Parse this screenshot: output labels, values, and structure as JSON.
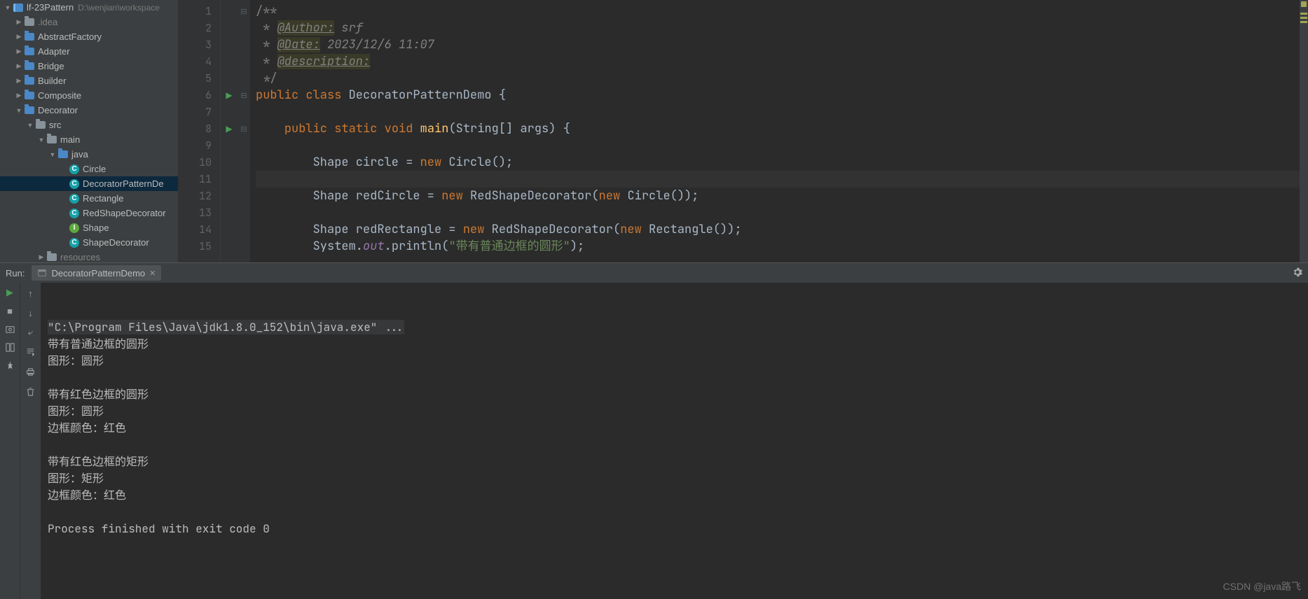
{
  "project": {
    "root_name": "lf-23Pattern",
    "root_path": "D:\\wenjian\\workspace",
    "items": [
      {
        "indent": 0,
        "arrow": "expanded",
        "icon": "module",
        "label": "lf-23Pattern",
        "hint": "D:\\wenjian\\workspace",
        "selected": false
      },
      {
        "indent": 1,
        "arrow": "collapsed",
        "icon": "folder",
        "label": ".idea",
        "dim": true
      },
      {
        "indent": 1,
        "arrow": "collapsed",
        "icon": "folder-blue",
        "label": "AbstractFactory"
      },
      {
        "indent": 1,
        "arrow": "collapsed",
        "icon": "folder-blue",
        "label": "Adapter"
      },
      {
        "indent": 1,
        "arrow": "collapsed",
        "icon": "folder-blue",
        "label": "Bridge"
      },
      {
        "indent": 1,
        "arrow": "collapsed",
        "icon": "folder-blue",
        "label": "Builder"
      },
      {
        "indent": 1,
        "arrow": "collapsed",
        "icon": "folder-blue",
        "label": "Composite"
      },
      {
        "indent": 1,
        "arrow": "expanded",
        "icon": "folder-blue",
        "label": "Decorator"
      },
      {
        "indent": 2,
        "arrow": "expanded",
        "icon": "folder",
        "label": "src"
      },
      {
        "indent": 3,
        "arrow": "expanded",
        "icon": "folder",
        "label": "main"
      },
      {
        "indent": 4,
        "arrow": "expanded",
        "icon": "folder-blue",
        "label": "java"
      },
      {
        "indent": 5,
        "arrow": "none",
        "icon": "class",
        "label": "Circle"
      },
      {
        "indent": 5,
        "arrow": "none",
        "icon": "class",
        "label": "DecoratorPatternDe",
        "selected": true
      },
      {
        "indent": 5,
        "arrow": "none",
        "icon": "class",
        "label": "Rectangle"
      },
      {
        "indent": 5,
        "arrow": "none",
        "icon": "class",
        "label": "RedShapeDecorator"
      },
      {
        "indent": 5,
        "arrow": "none",
        "icon": "iface",
        "label": "Shape"
      },
      {
        "indent": 5,
        "arrow": "none",
        "icon": "class",
        "label": "ShapeDecorator"
      },
      {
        "indent": 3,
        "arrow": "collapsed",
        "icon": "folder",
        "label": "resources",
        "dim": true
      }
    ]
  },
  "editor": {
    "line_numbers": [
      "1",
      "2",
      "3",
      "4",
      "5",
      "6",
      "7",
      "8",
      "9",
      "10",
      "11",
      "12",
      "13",
      "14",
      "15"
    ],
    "run_marker_lines": [
      6,
      8
    ],
    "fold_markers": {
      "1": "⊟",
      "6": "⊟",
      "8": "⊟"
    },
    "caret_line": 11,
    "code": {
      "l1": "/**",
      "l2_tag": "@Author:",
      "l2_val": "srf",
      "l3_tag": "@Date:",
      "l3_val": "2023/12/6 11:07",
      "l4_tag": "@description:",
      "l5": " */",
      "l6_kw1": "public",
      "l6_kw2": "class",
      "l6_name": "DecoratorPatternDemo",
      "l6_brace": " {",
      "l8_kw1": "public",
      "l8_kw2": "static",
      "l8_kw3": "void",
      "l8_name": "main",
      "l8_rest": "(String[] args) {",
      "l10_t": "Shape circle = ",
      "l10_kw": "new",
      "l10_rest": " Circle();",
      "l12_t": "Shape redCircle = ",
      "l12_kw": "new",
      "l12_rest": " RedShapeDecorator(",
      "l12_kw2": "new",
      "l12_rest2": " Circle());",
      "l14_t": "Shape redRectangle = ",
      "l14_kw": "new",
      "l14_rest": " RedShapeDecorator(",
      "l14_kw2": "new",
      "l14_rest2": " Rectangle());",
      "l15_t": "System.",
      "l15_f": "out",
      "l15_t2": ".println(",
      "l15_str": "\"带有普通边框的圆形\"",
      "l15_t3": ");"
    }
  },
  "run": {
    "label": "Run:",
    "tab": "DecoratorPatternDemo",
    "console_lines": [
      {
        "cmd": true,
        "text": "\"C:\\Program Files\\Java\\jdk1.8.0_152\\bin\\java.exe\" ..."
      },
      {
        "text": "带有普通边框的圆形"
      },
      {
        "text": "图形：圆形"
      },
      {
        "text": ""
      },
      {
        "text": "带有红色边框的圆形"
      },
      {
        "text": "图形：圆形"
      },
      {
        "text": "边框颜色：红色"
      },
      {
        "text": ""
      },
      {
        "text": "带有红色边框的矩形"
      },
      {
        "text": "图形：矩形"
      },
      {
        "text": "边框颜色：红色"
      },
      {
        "text": ""
      },
      {
        "text": "Process finished with exit code 0"
      }
    ]
  },
  "watermark": "CSDN @java路飞"
}
